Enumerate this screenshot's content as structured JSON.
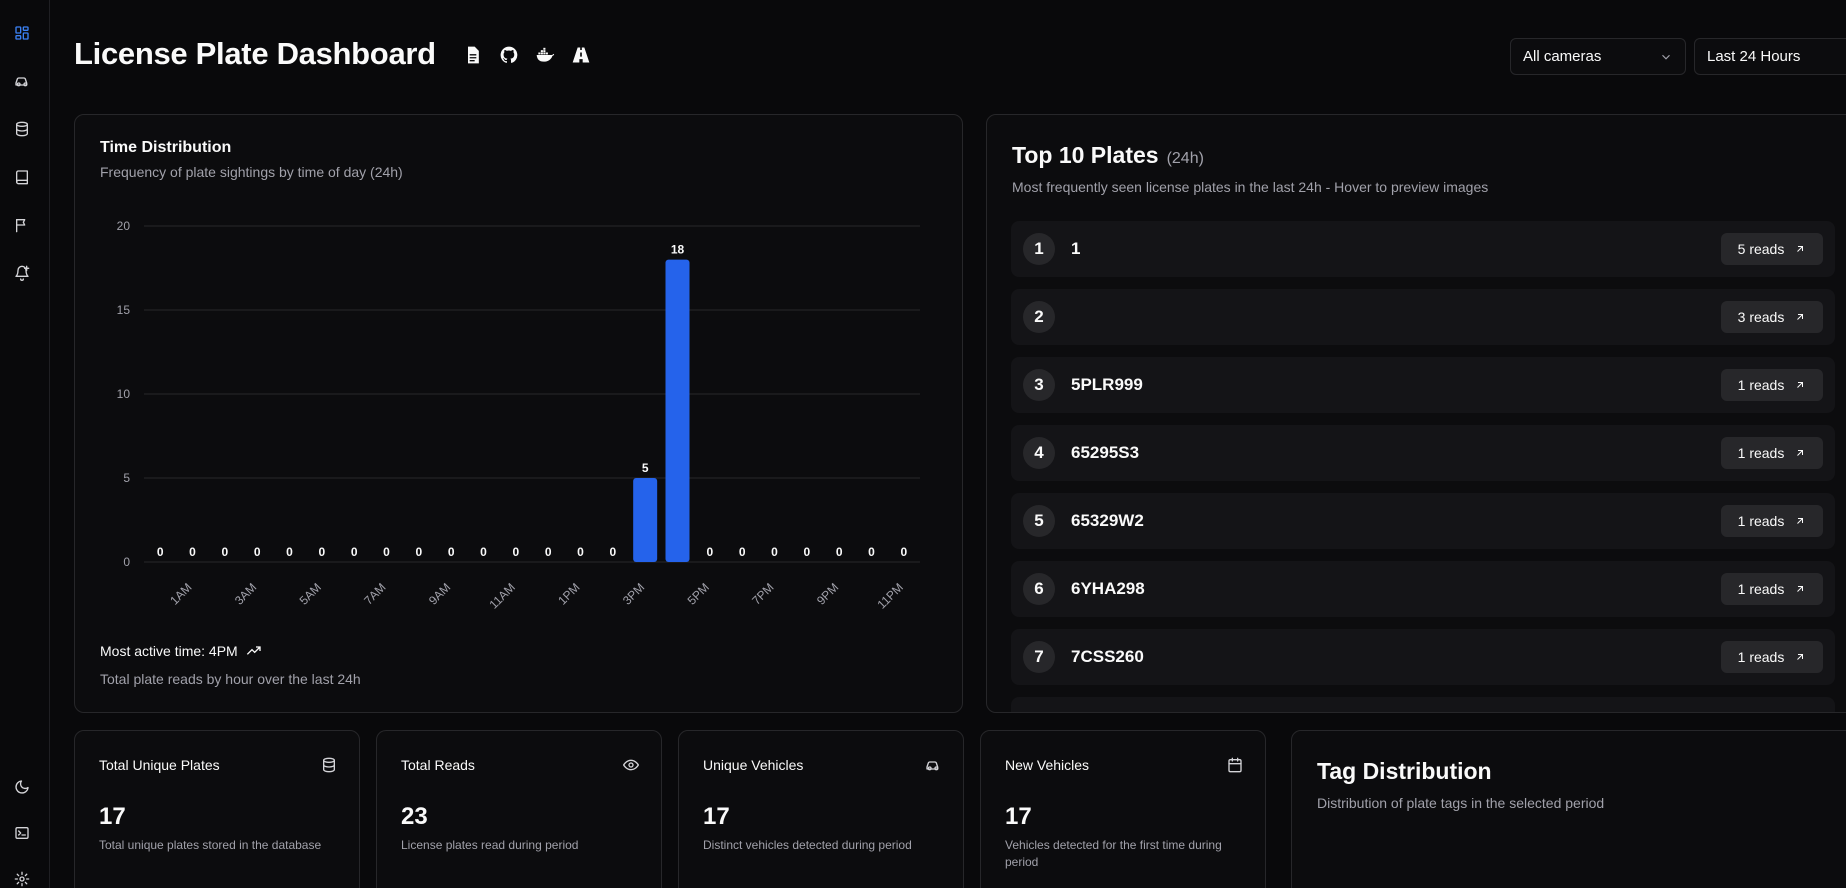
{
  "header": {
    "title": "License Plate Dashboard",
    "icons": [
      "document-icon",
      "github-icon",
      "docker-icon",
      "road-icon"
    ],
    "camera_select": "All cameras",
    "time_select": "Last 24 Hours"
  },
  "sidebar": {
    "items": [
      "dashboard-icon",
      "car-icon",
      "database-icon",
      "book-icon",
      "flag-icon",
      "bell-plus-icon"
    ],
    "bottom": [
      "moon-icon",
      "terminal-icon",
      "settings-icon"
    ]
  },
  "time_distribution": {
    "title": "Time Distribution",
    "subtitle": "Frequency of plate sightings by time of day (24h)",
    "most_active": "Most active time: 4PM",
    "footer": "Total plate reads by hour over the last 24h"
  },
  "chart_data": {
    "type": "bar",
    "categories": [
      "12AM",
      "1AM",
      "2AM",
      "3AM",
      "4AM",
      "5AM",
      "6AM",
      "7AM",
      "8AM",
      "9AM",
      "10AM",
      "11AM",
      "12PM",
      "1PM",
      "2PM",
      "3PM",
      "4PM",
      "5PM",
      "6PM",
      "7PM",
      "8PM",
      "9PM",
      "10PM",
      "11PM"
    ],
    "x_tick_labels": [
      "1AM",
      "3AM",
      "5AM",
      "7AM",
      "9AM",
      "11AM",
      "1PM",
      "3PM",
      "5PM",
      "7PM",
      "9PM",
      "11PM"
    ],
    "values": [
      0,
      0,
      0,
      0,
      0,
      0,
      0,
      0,
      0,
      0,
      0,
      0,
      0,
      0,
      0,
      5,
      18,
      0,
      0,
      0,
      0,
      0,
      0,
      0
    ],
    "ylim": [
      0,
      20
    ],
    "y_ticks": [
      "0",
      "5",
      "10",
      "15",
      "20"
    ],
    "grid": true,
    "bar_color": "#2563eb"
  },
  "top_plates": {
    "title": "Top 10 Plates",
    "badge": "(24h)",
    "subtitle": "Most frequently seen license plates in the last 24h - Hover to preview images",
    "rows": [
      {
        "rank": "1",
        "plate": "1",
        "reads": "5 reads"
      },
      {
        "rank": "2",
        "plate": "",
        "reads": "3 reads"
      },
      {
        "rank": "3",
        "plate": "5PLR999",
        "reads": "1 reads"
      },
      {
        "rank": "4",
        "plate": "65295S3",
        "reads": "1 reads"
      },
      {
        "rank": "5",
        "plate": "65329W2",
        "reads": "1 reads"
      },
      {
        "rank": "6",
        "plate": "6YHA298",
        "reads": "1 reads"
      },
      {
        "rank": "7",
        "plate": "7CSS260",
        "reads": "1 reads"
      }
    ]
  },
  "stats": [
    {
      "title": "Total Unique Plates",
      "value": "17",
      "desc": "Total unique plates stored in the database",
      "icon": "database-icon"
    },
    {
      "title": "Total Reads",
      "value": "23",
      "desc": "License plates read during period",
      "icon": "eye-icon"
    },
    {
      "title": "Unique Vehicles",
      "value": "17",
      "desc": "Distinct vehicles detected during period",
      "icon": "car-icon"
    },
    {
      "title": "New Vehicles",
      "value": "17",
      "desc": "Vehicles detected for the first time during period",
      "icon": "calendar-icon"
    }
  ],
  "tag_distribution": {
    "title": "Tag Distribution",
    "subtitle": "Distribution of plate tags in the selected period"
  }
}
